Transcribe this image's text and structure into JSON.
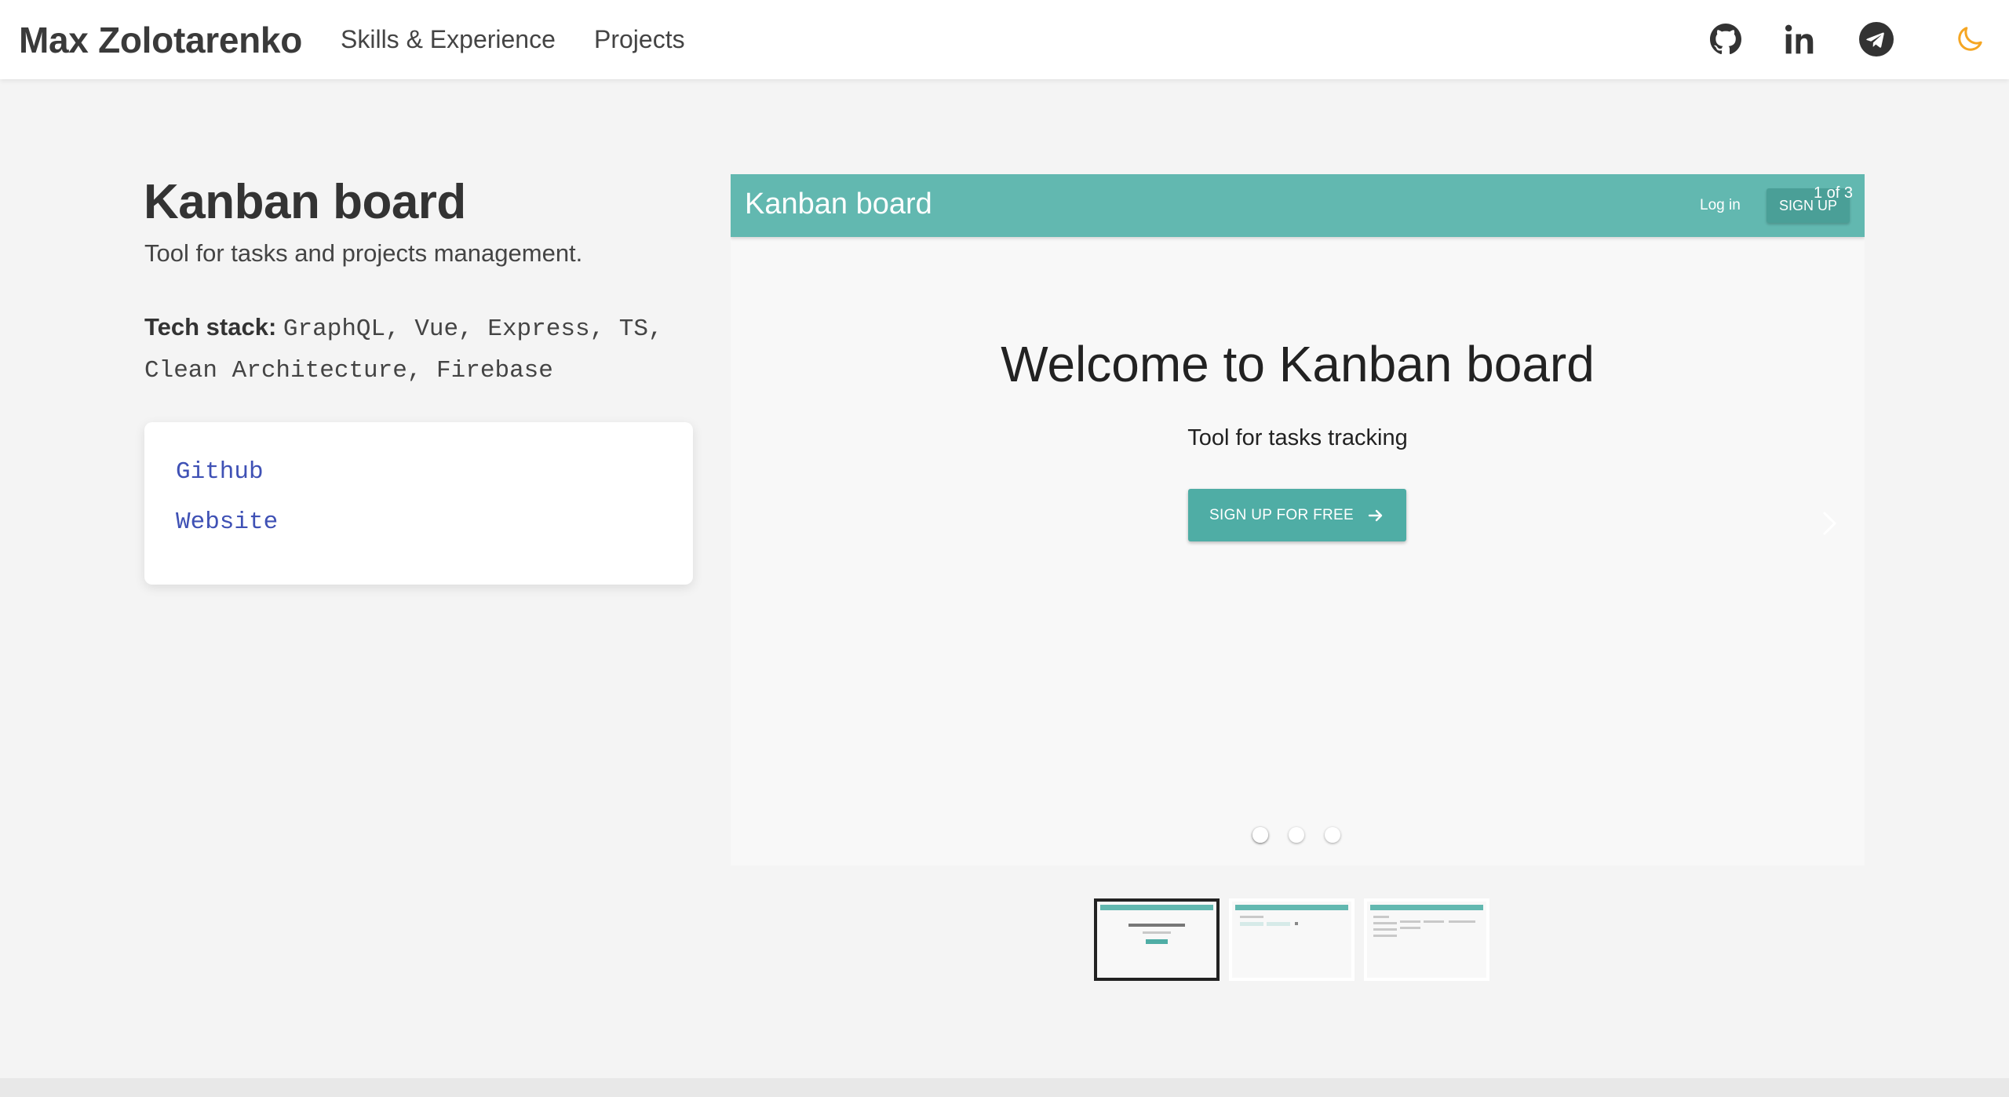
{
  "header": {
    "brand": "Max Zolotarenko",
    "nav": [
      {
        "label": "Skills & Experience"
      },
      {
        "label": "Projects"
      }
    ],
    "social_icons": [
      "github-icon",
      "linkedin-icon",
      "telegram-icon"
    ],
    "theme_icon": "moon-icon",
    "theme_color": "#f5a623"
  },
  "project": {
    "title": "Kanban board",
    "description": "Tool for tasks and projects management.",
    "tech_label": "Tech stack:",
    "tech_list": "GraphQL, Vue, Express, TS, Clean Architecture, Firebase",
    "links": [
      {
        "label": "Github"
      },
      {
        "label": "Website"
      }
    ],
    "link_color": "#3f51b5"
  },
  "carousel": {
    "counter": "1 of 3",
    "slide": {
      "brand": "Kanban board",
      "login": "Log in",
      "signup": "SIGN UP",
      "heading": "Welcome to Kanban board",
      "subheading": "Tool for tasks tracking",
      "cta": "SIGN UP FOR FREE",
      "accent": "#62b8b0"
    },
    "dots": 3,
    "active_index": 0
  }
}
